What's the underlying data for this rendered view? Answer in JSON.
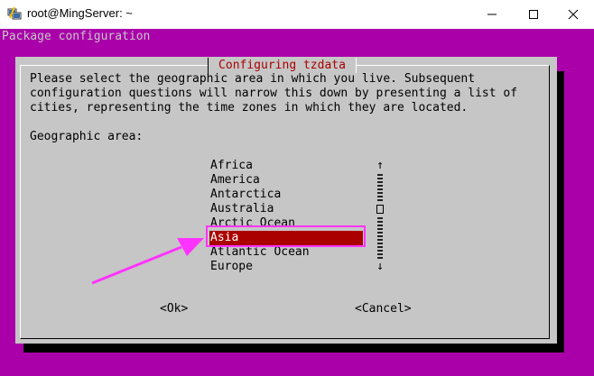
{
  "window": {
    "title": "root@MingServer: ~",
    "minimize_icon": "minimize-icon",
    "maximize_icon": "maximize-icon",
    "close_icon": "close-icon"
  },
  "terminal": {
    "header": "Package configuration"
  },
  "dialog": {
    "title": "Configuring tzdata",
    "prompt_lines": [
      "Please select the geographic area in which you live. Subsequent",
      "configuration questions will narrow this down by presenting a list of",
      "cities, representing the time zones in which they are located."
    ],
    "field_label": "Geographic area:",
    "options": [
      "Africa",
      "America",
      "Antarctica",
      "Australia",
      "Arctic Ocean",
      "Asia",
      "Atlantic Ocean",
      "Europe"
    ],
    "selected_option": "Asia",
    "scroll_up": "↑",
    "scroll_down": "↓",
    "ok_label": "<Ok>",
    "cancel_label": "<Cancel>"
  },
  "colors": {
    "background": "#aa00aa",
    "dialog": "#c6c6c6",
    "selection": "#aa0000",
    "annotation": "#ff33ff"
  }
}
